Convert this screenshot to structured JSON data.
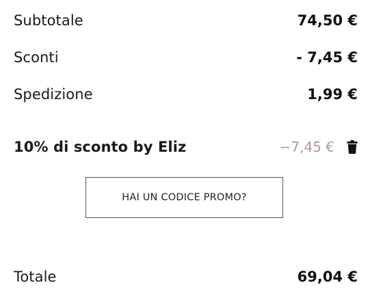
{
  "summary": {
    "subtotal": {
      "label": "Subtotale",
      "value": "74,50 €"
    },
    "discounts": {
      "label": "Sconti",
      "value": "- 7,45 €"
    },
    "shipping": {
      "label": "Spedizione",
      "value": "1,99 €"
    }
  },
  "promo_applied": {
    "label": "10% di sconto by Eliz",
    "value": "−7,45 €",
    "value_color": "#b596a5",
    "remove_icon": "trash-icon"
  },
  "promo_code_button": {
    "label": "HAI UN CODICE PROMO?"
  },
  "total": {
    "label": "Totale",
    "value": "69,04 €"
  }
}
